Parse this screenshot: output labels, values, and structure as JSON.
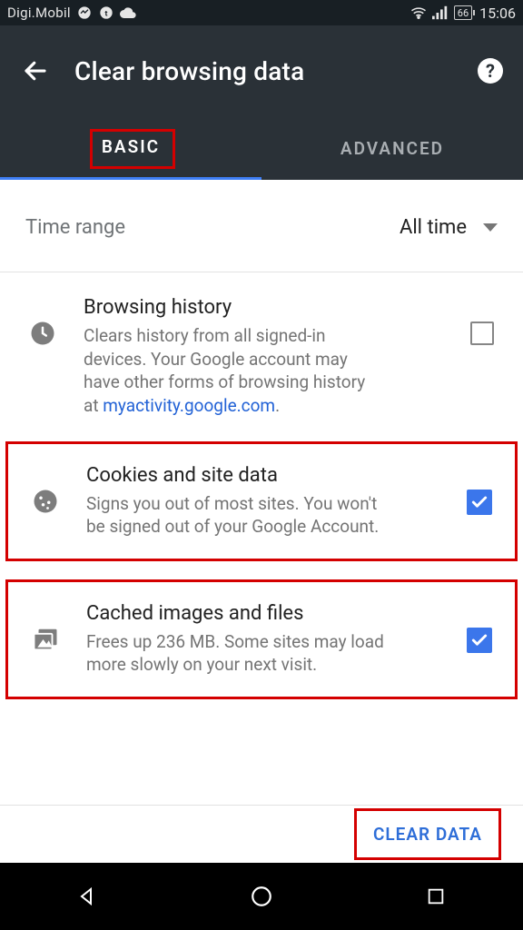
{
  "statusbar": {
    "carrier": "Digi.Mobil",
    "battery": "66",
    "clock": "15:06"
  },
  "header": {
    "title": "Clear browsing data",
    "help": "?"
  },
  "tabs": {
    "basic": "BASIC",
    "advanced": "ADVANCED"
  },
  "time_range": {
    "label": "Time range",
    "value": "All time"
  },
  "options": [
    {
      "title": "Browsing history",
      "desc_pre": "Clears history from all signed-in devices. Your Google account may have other forms of browsing history at ",
      "desc_link": "myactivity.google.com",
      "desc_post": ".",
      "checked": false
    },
    {
      "title": "Cookies and site data",
      "desc": "Signs you out of most sites. You won't be signed out of your Google Account.",
      "checked": true
    },
    {
      "title": "Cached images and files",
      "desc": "Frees up 236 MB. Some sites may load more slowly on your next visit.",
      "checked": true
    }
  ],
  "footer": {
    "clear": "CLEAR DATA"
  }
}
